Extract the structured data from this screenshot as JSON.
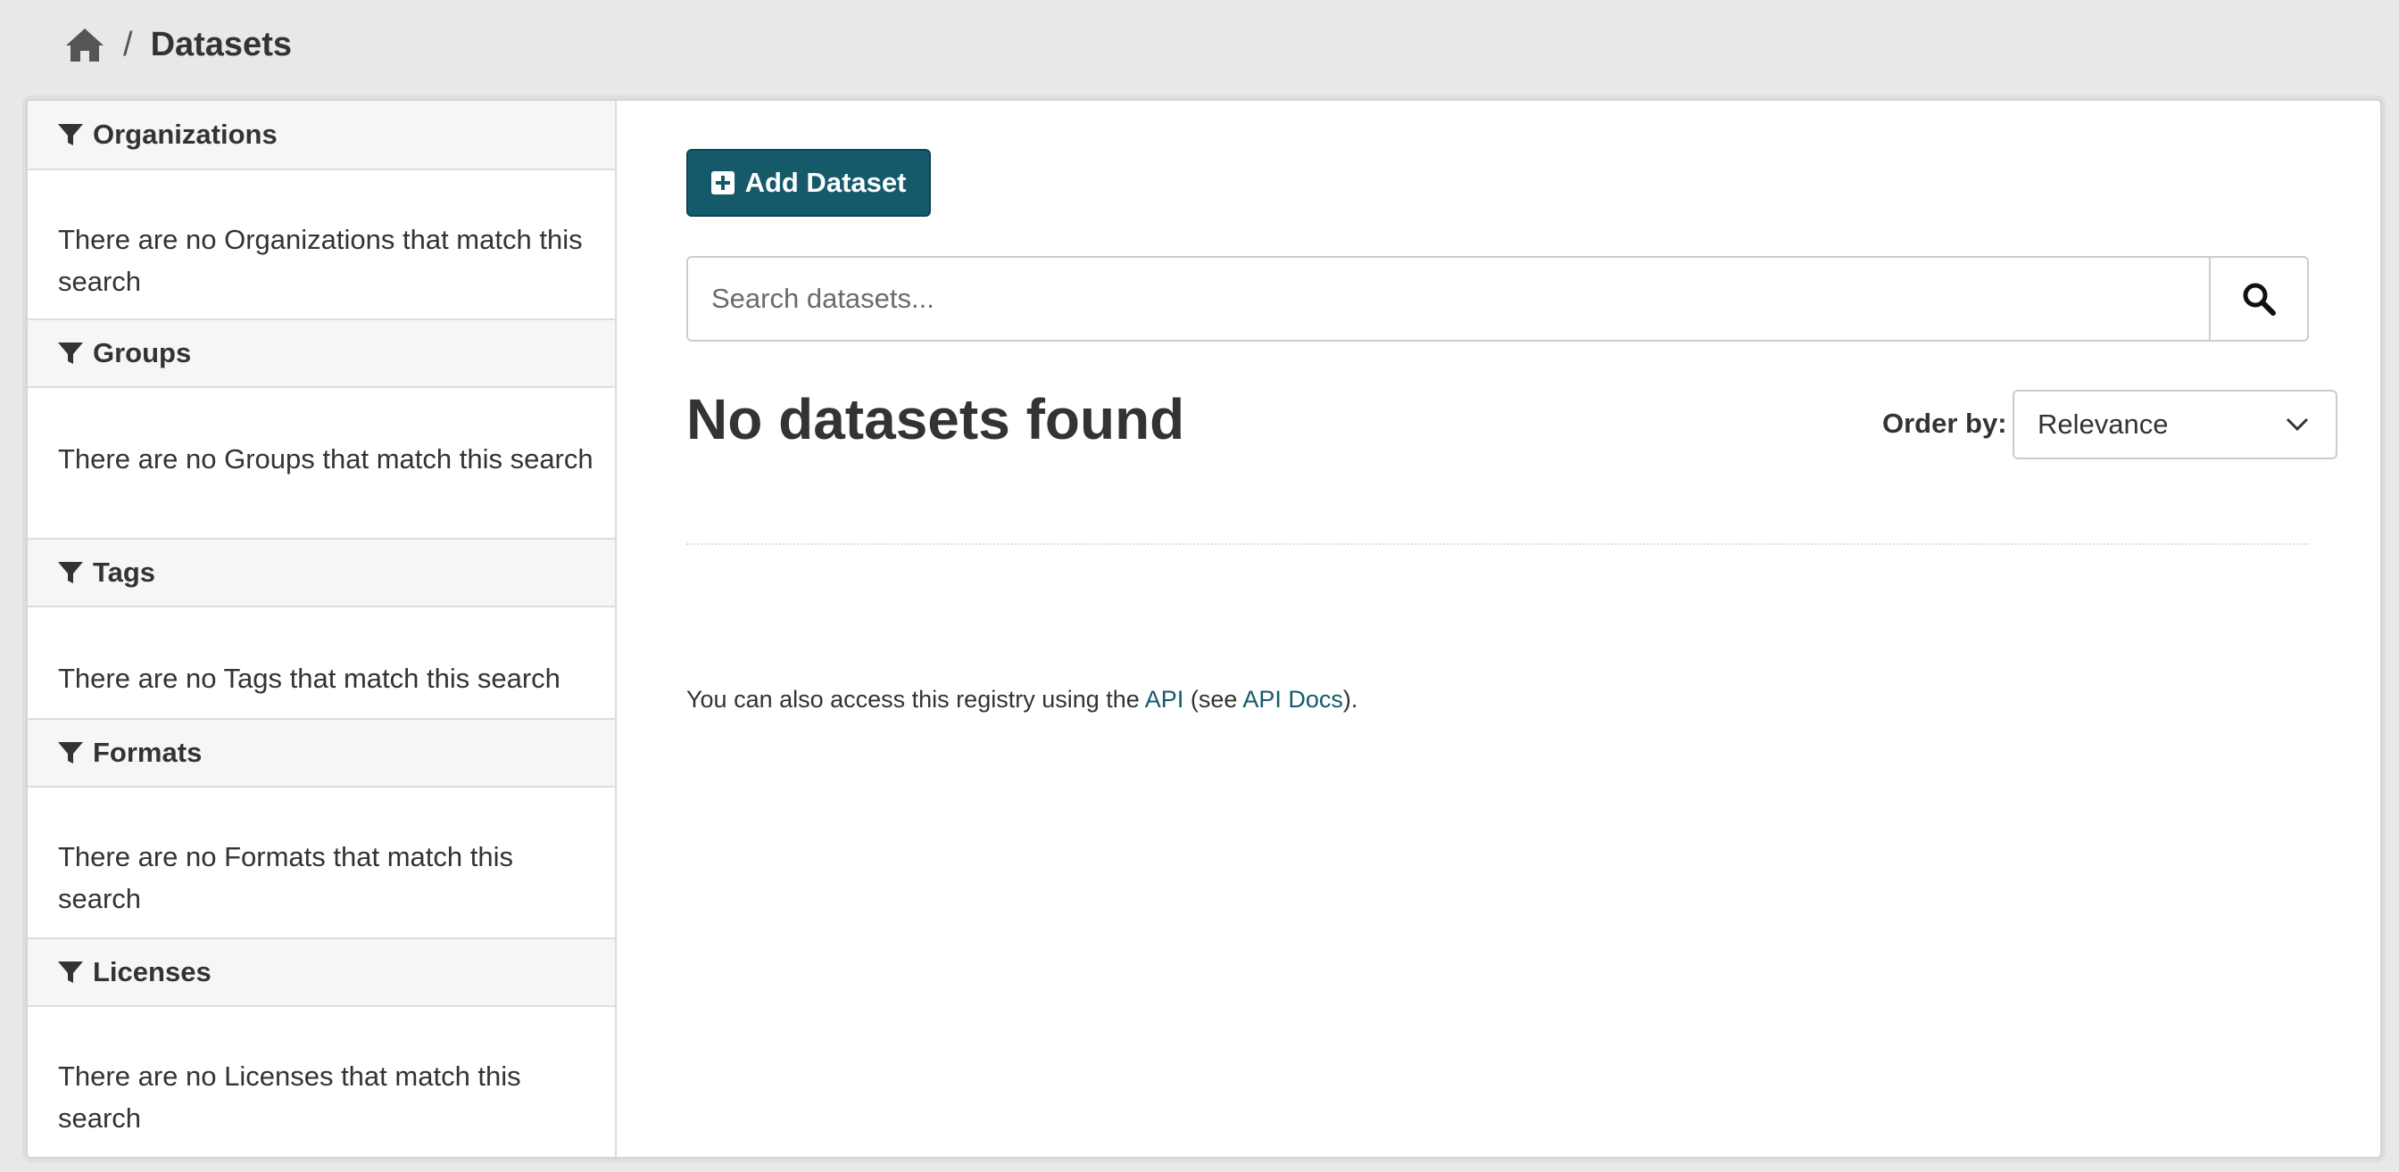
{
  "breadcrumb": {
    "home_icon": "home-icon",
    "separator": "/",
    "current": "Datasets"
  },
  "facets": [
    {
      "title": "Organizations",
      "empty_text": "There are no Organizations that match this search"
    },
    {
      "title": "Groups",
      "empty_text": "There are no Groups that match this search"
    },
    {
      "title": "Tags",
      "empty_text": "There are no Tags that match this search"
    },
    {
      "title": "Formats",
      "empty_text": "There are no Formats that match this search"
    },
    {
      "title": "Licenses",
      "empty_text": "There are no Licenses that match this search"
    }
  ],
  "main": {
    "add_button": "Add Dataset",
    "search": {
      "placeholder": "Search datasets...",
      "value": ""
    },
    "results_title": "No datasets found",
    "order_label": "Order by:",
    "order_value": "Relevance",
    "api_note": {
      "prefix": "You can also access this registry using the ",
      "api_link": "API",
      "middle": " (see ",
      "docs_link": "API Docs",
      "suffix": ")."
    }
  },
  "colors": {
    "accent": "#155a6b",
    "background": "#e8e8e8",
    "facet_header": "#f6f6f6"
  }
}
